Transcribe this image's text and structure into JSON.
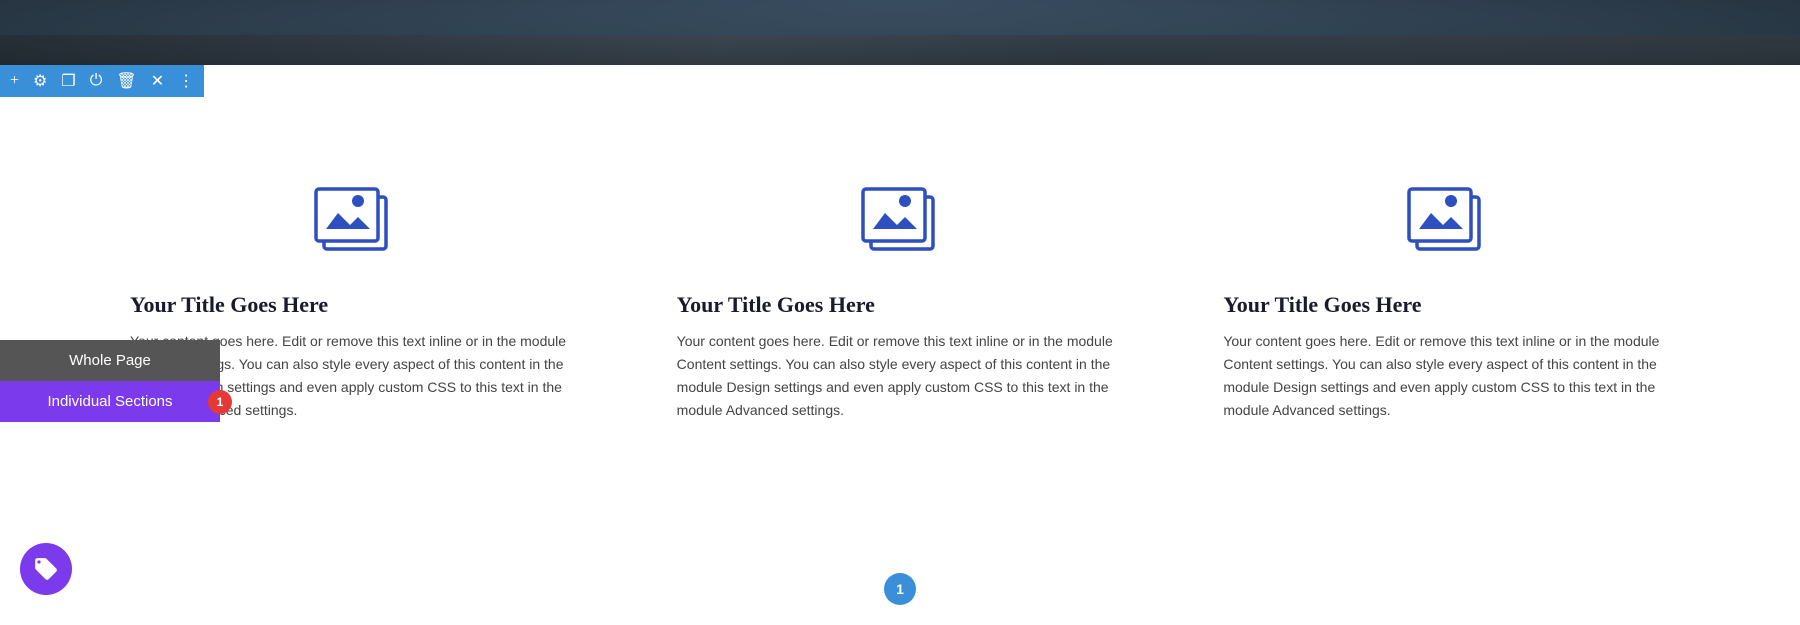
{
  "hero": {
    "alt": "Hero landscape photo"
  },
  "toolbar": {
    "icons": [
      {
        "name": "plus-icon",
        "symbol": "+"
      },
      {
        "name": "settings-icon",
        "symbol": "⚙"
      },
      {
        "name": "copy-icon",
        "symbol": "❐"
      },
      {
        "name": "power-icon",
        "symbol": "⏻"
      },
      {
        "name": "trash-icon",
        "symbol": "🗑"
      },
      {
        "name": "close-icon",
        "symbol": "✕"
      },
      {
        "name": "more-icon",
        "symbol": "⋮"
      }
    ]
  },
  "columns": [
    {
      "title": "Your Title Goes Here",
      "text": "Your content goes here. Edit or remove this text inline or in the module Content settings. You can also style every aspect of this content in the module Design settings and even apply custom CSS to this text in the module Advanced settings."
    },
    {
      "title": "Your Title Goes Here",
      "text": "Your content goes here. Edit or remove this text inline or in the module Content settings. You can also style every aspect of this content in the module Design settings and even apply custom CSS to this text in the module Advanced settings."
    },
    {
      "title": "Your Title Goes Here",
      "text": "Your content goes here. Edit or remove this text inline or in the module Content settings. You can also style every aspect of this content in the module Design settings and even apply custom CSS to this text in the module Advanced settings."
    }
  ],
  "sidebar": {
    "whole_page_label": "Whole Page",
    "individual_sections_label": "Individual Sections",
    "badge_count": "1"
  },
  "pagination": {
    "current": "1"
  }
}
